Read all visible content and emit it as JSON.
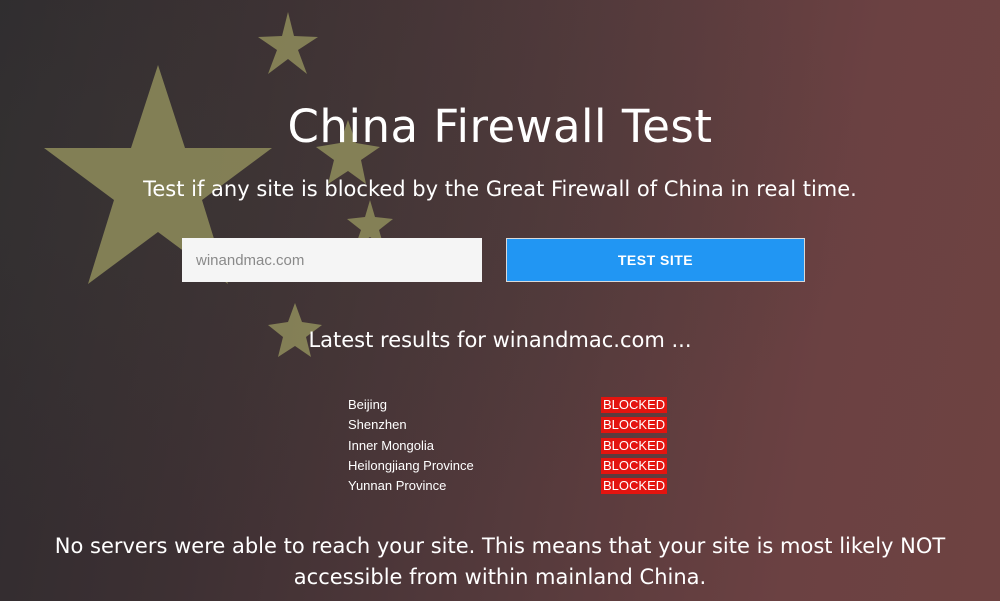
{
  "page": {
    "title": "China Firewall Test",
    "subtitle": "Test if any site is blocked by the Great Firewall of China in real time."
  },
  "form": {
    "url_value": "",
    "url_placeholder": "winandmac.com",
    "button_label": "TEST SITE"
  },
  "results": {
    "heading": "Latest results for winandmac.com ...",
    "rows": [
      {
        "location": "Beijing",
        "status": "BLOCKED"
      },
      {
        "location": "Shenzhen",
        "status": "BLOCKED"
      },
      {
        "location": "Inner Mongolia",
        "status": "BLOCKED"
      },
      {
        "location": "Heilongjiang Province",
        "status": "BLOCKED"
      },
      {
        "location": "Yunnan Province",
        "status": "BLOCKED"
      }
    ],
    "conclusion": "No servers were able to reach your site. This means that your site is most likely NOT accessible from within mainland China."
  },
  "colors": {
    "button_bg": "#2196f3",
    "blocked_bg": "#e3140f",
    "star_color": "#9c9a63"
  },
  "icons": {
    "background_stars": "star-icon"
  }
}
